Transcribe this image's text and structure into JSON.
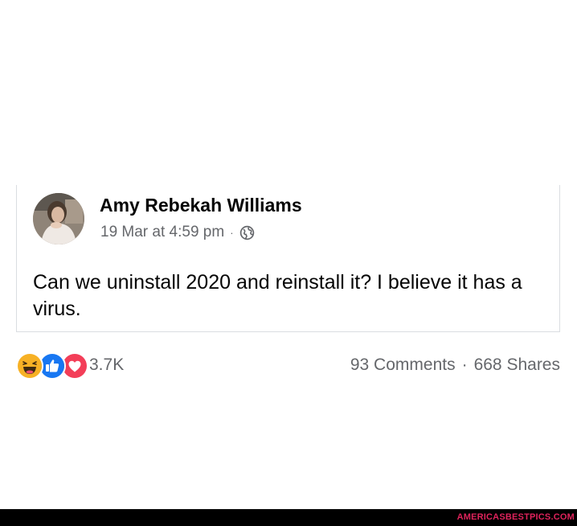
{
  "post": {
    "author": "Amy Rebekah Williams",
    "timestamp": "19 Mar at 4:59 pm",
    "separator": "·",
    "privacy_icon": "globe-icon",
    "text": "Can we uninstall 2020 and reinstall it? I believe it has a virus."
  },
  "engagement": {
    "reaction_icons": [
      "haha-icon",
      "like-icon",
      "love-icon"
    ],
    "reaction_count": "3.7K",
    "comments": "93 Comments",
    "separator": "·",
    "shares": "668 Shares"
  },
  "watermark": "AMERICASBESTPICS.COM",
  "colors": {
    "like_blue": "#1877f2",
    "love_red": "#f33e58",
    "haha_yellow": "#f7b125",
    "secondary_text": "#65676b",
    "watermark_pink": "#e0235c"
  }
}
